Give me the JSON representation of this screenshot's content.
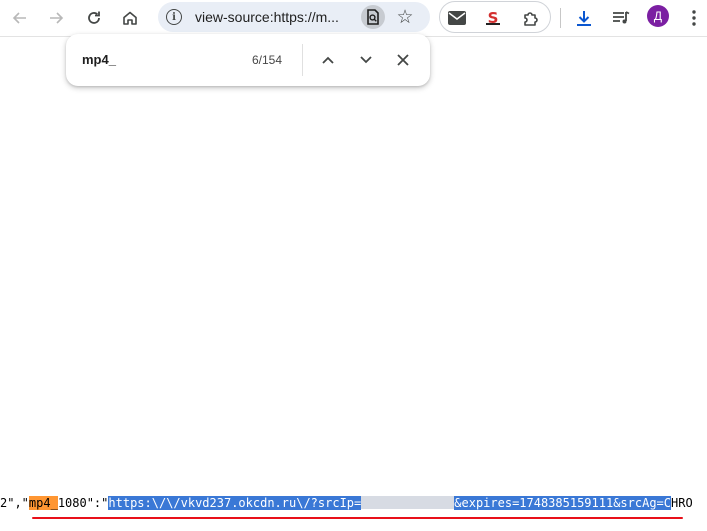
{
  "toolbar": {
    "back_icon": "arrow-left-icon",
    "forward_icon": "arrow-right-icon",
    "reload_icon": "reload-icon",
    "home_icon": "home-icon",
    "omnibox": {
      "url_text": "view-source:https://m...",
      "info_icon": "info-icon",
      "zoom_icon": "page-search-icon",
      "bookmark_icon": "star-icon"
    },
    "extensions": [
      {
        "name": "mail-icon"
      },
      {
        "name": "s-extension-icon",
        "label": "S"
      },
      {
        "name": "puzzle-icon"
      }
    ],
    "download_icon": "download-icon",
    "media_icon": "media-queue-icon",
    "profile_initial": "Д",
    "menu_icon": "kebab-menu-icon",
    "colors": {
      "download": "#0b57d0",
      "avatar": "#7b1fa2"
    }
  },
  "find_bar": {
    "query": "mp4_",
    "count": "6/154"
  },
  "source": {
    "prefix": "2\",\"",
    "match": "mp4_",
    "after_match": "1080\":\"",
    "selected_start": "https:\\/\\/vkvd237.okcdn.ru\\/?srcIp=",
    "selected_end": "&expires=1748385159111&srcAg=C",
    "trailing": "HRO",
    "colors": {
      "match": "#ff9632",
      "selection": "#3a78d6",
      "underline": "#e8101a"
    }
  }
}
